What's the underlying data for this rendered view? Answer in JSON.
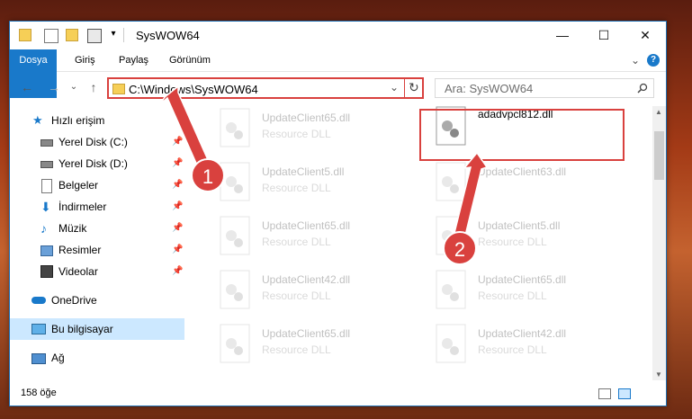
{
  "window": {
    "title": "SysWOW64",
    "controls": {
      "minimize": "—",
      "maximize": "☐",
      "close": "✕"
    }
  },
  "ribbon": {
    "tabs": [
      "Dosya",
      "Giriş",
      "Paylaş",
      "Görünüm"
    ],
    "expand": "⌄",
    "help": "?"
  },
  "address": {
    "path": "C:\\Windows\\SysWOW64",
    "dropdown": "⌄",
    "refresh": "↻"
  },
  "nav": {
    "back": "←",
    "forward": "→",
    "recent": "⌄",
    "up": "↑"
  },
  "search": {
    "placeholder": "Ara: SysWOW64",
    "icon": "search-icon"
  },
  "sidebar": {
    "items": [
      {
        "label": "Hızlı erişim",
        "icon": "star-icon",
        "pinned": false
      },
      {
        "label": "Yerel Disk (C:)",
        "icon": "drive-icon",
        "pinned": true
      },
      {
        "label": "Yerel Disk (D:)",
        "icon": "drive-icon",
        "pinned": true
      },
      {
        "label": "Belgeler",
        "icon": "documents-icon",
        "pinned": true
      },
      {
        "label": "İndirmeler",
        "icon": "download-icon",
        "pinned": true
      },
      {
        "label": "Müzik",
        "icon": "music-icon",
        "pinned": true
      },
      {
        "label": "Resimler",
        "icon": "pictures-icon",
        "pinned": true
      },
      {
        "label": "Videolar",
        "icon": "videos-icon",
        "pinned": true
      },
      {
        "label": "OneDrive",
        "icon": "cloud-icon",
        "pinned": false
      },
      {
        "label": "Bu bilgisayar",
        "icon": "computer-icon",
        "pinned": false
      },
      {
        "label": "Ağ",
        "icon": "network-icon",
        "pinned": false
      }
    ],
    "pin_glyph": "📌"
  },
  "files": [
    {
      "name": "UpdateClient65.dll",
      "type": "Resource DLL",
      "faded": true
    },
    {
      "name": "adadvpcl812.dll",
      "type": "",
      "faded": false
    },
    {
      "name": "UpdateClient5.dll",
      "type": "Resource DLL",
      "faded": true
    },
    {
      "name": "UpdateClient63.dll",
      "type": "",
      "faded": true
    },
    {
      "name": "UpdateClient65.dll",
      "type": "Resource DLL",
      "faded": true
    },
    {
      "name": "UpdateClient5.dll",
      "type": "Resource DLL",
      "faded": true
    },
    {
      "name": "UpdateClient42.dll",
      "type": "Resource DLL",
      "faded": true
    },
    {
      "name": "UpdateClient65.dll",
      "type": "Resource DLL",
      "faded": true
    },
    {
      "name": "UpdateClient65.dll",
      "type": "Resource DLL",
      "faded": true
    },
    {
      "name": "UpdateClient42.dll",
      "type": "Resource DLL",
      "faded": true
    }
  ],
  "status": {
    "count": "158 öğe"
  },
  "annotations": {
    "callout1": "1",
    "callout2": "2",
    "color": "#d9413e"
  }
}
